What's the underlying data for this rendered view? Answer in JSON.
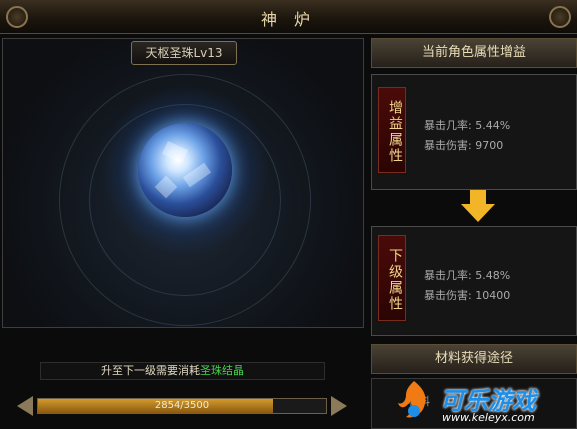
{
  "window": {
    "title": "神 炉"
  },
  "orb": {
    "name": "天枢圣珠Lv13"
  },
  "current_bonus": {
    "header": "当前角色属性增益",
    "banner": "增益属性",
    "stats": [
      {
        "label": "暴击几率:",
        "value": "5.44%"
      },
      {
        "label": "暴击伤害:",
        "value": "9700"
      }
    ]
  },
  "next_level": {
    "banner": "下级属性",
    "stats": [
      {
        "label": "暴击几率:",
        "value": "5.48%"
      },
      {
        "label": "暴击伤害:",
        "value": "10400"
      }
    ]
  },
  "upgrade": {
    "cost_prefix": "升至下一级需要消耗",
    "cost_item": "圣珠结晶",
    "progress_text": "2854/3500",
    "progress_current": 2854,
    "progress_max": 3500
  },
  "materials": {
    "header": "材料获得途径",
    "label": "材料"
  },
  "watermark": {
    "brand": "可乐游戏",
    "url": "www.keleyx.com"
  },
  "colors": {
    "highlight_green": "#46d44b",
    "progress_gold": "#d39a2c",
    "arrow_gold": "#f2b528"
  }
}
